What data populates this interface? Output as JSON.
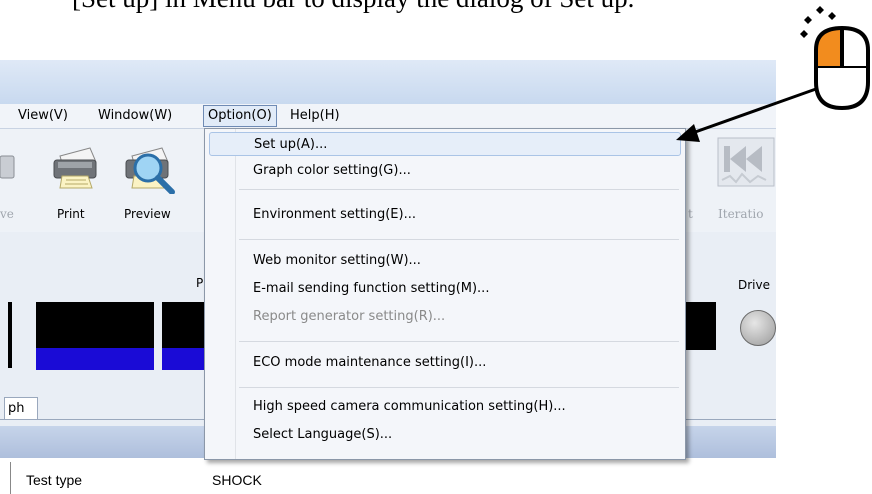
{
  "caption_text": "[Set up] in Menu bar to display the dialog of Set up.",
  "menubar": {
    "view": "View(V)",
    "window": "Window(W)",
    "option": "Option(O)",
    "help": "Help(H)"
  },
  "toolbar": {
    "save_partial": "ve",
    "print": "Print",
    "preview": "Preview",
    "t_partial": "t",
    "iteration_partial": "Iteratio"
  },
  "panel": {
    "p_label": "P",
    "drive_label": "Drive"
  },
  "tab": {
    "label": "ph"
  },
  "table": {
    "key": "Test type",
    "value": "SHOCK"
  },
  "option_menu": {
    "items": [
      {
        "label": "Set up(A)...",
        "state": "highlighted"
      },
      {
        "label": "Graph color setting(G)..."
      },
      {
        "label": "Environment setting(E)..."
      },
      {
        "label": "Web monitor setting(W)..."
      },
      {
        "label": "E-mail sending function setting(M)..."
      },
      {
        "label": "Report generator setting(R)...",
        "state": "disabled"
      },
      {
        "label": "ECO mode maintenance setting(I)..."
      },
      {
        "label": "High speed camera communication setting(H)..."
      },
      {
        "label": "Select Language(S)..."
      }
    ]
  },
  "colors": {
    "mouse_left_button": "#f28c1e",
    "display_blue": "#1a0bd6",
    "menu_highlight": "#e6eef9"
  },
  "icons": [
    "printer-icon",
    "preview-magnifier-icon",
    "iteration-icon",
    "mouse-icon",
    "drive-knob-icon"
  ]
}
